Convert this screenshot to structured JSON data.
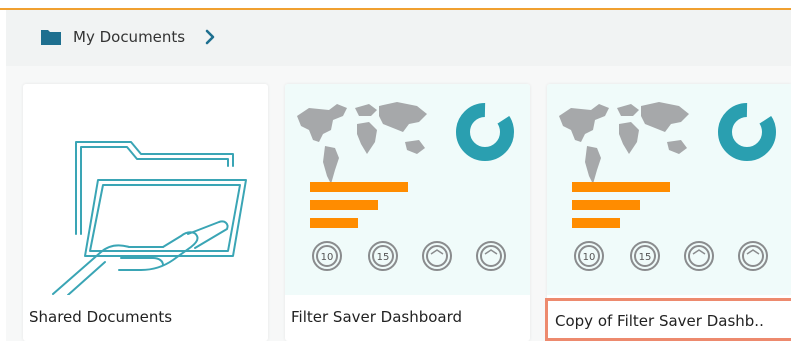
{
  "breadcrumb": {
    "icon": "folder-icon",
    "label": "My Documents",
    "chevron": "chevron-right-icon"
  },
  "tiles": [
    {
      "name": "Shared Documents",
      "thumbnail": "shared-folder-hand-icon"
    },
    {
      "name": "Filter Saver Dashboard",
      "thumbnail": "dashboard-thumbnail",
      "gauges": [
        "10",
        "15",
        "",
        ""
      ]
    },
    {
      "name": "Copy of Filter Saver Dashb..",
      "thumbnail": "dashboard-thumbnail",
      "gauges": [
        "10",
        "15",
        "",
        ""
      ]
    }
  ],
  "colors": {
    "accent_top": "#f0a030",
    "folder": "#1e6f8f",
    "map": "#a6a8aa",
    "donut": "#2a9fb0",
    "bars": "#ff8c00",
    "selection": "#ed8a6e",
    "thumb_bg": "#f0fbfa"
  }
}
